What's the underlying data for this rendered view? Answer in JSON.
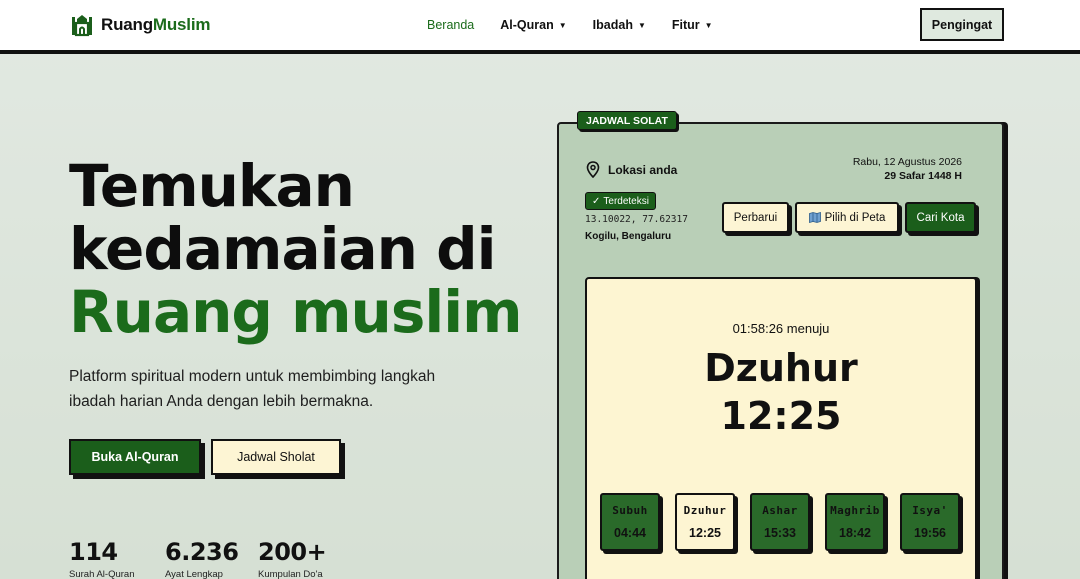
{
  "brand": {
    "name_a": "Ruang",
    "name_b": "Muslim"
  },
  "nav": {
    "items": [
      {
        "label": "Beranda"
      },
      {
        "label": "Al-Quran"
      },
      {
        "label": "Ibadah"
      },
      {
        "label": "Fitur"
      }
    ],
    "cta": "Pengingat"
  },
  "hero": {
    "line1": "Temukan",
    "line2": "kedamaian di",
    "line3": "Ruang muslim",
    "description": "Platform spiritual modern untuk membimbing langkah ibadah harian Anda dengan lebih bermakna.",
    "btn_primary": "Buka Al-Quran",
    "btn_secondary": "Jadwal Sholat"
  },
  "stats": [
    {
      "value": "114",
      "label": "Surah Al-Quran"
    },
    {
      "value": "6.236",
      "label": "Ayat Lengkap"
    },
    {
      "value": "200+",
      "label": "Kumpulan Do'a"
    }
  ],
  "schedule": {
    "badge": "JADWAL SOLAT",
    "location_label": "Lokasi anda",
    "date_gregorian": "Rabu, 12 Agustus 2026",
    "date_hijri": "29 Safar 1448 H",
    "detected_label": "Terdeteksi",
    "coordinates": "13.10022, 77.62317",
    "city": "Kogilu, Bengaluru",
    "btn_refresh": "Perbarui",
    "btn_map": "Pilih di Peta",
    "btn_search": "Cari Kota",
    "countdown_text": "01:58:26 menuju",
    "next_prayer": "Dzuhur",
    "next_time": "12:25",
    "times": [
      {
        "name": "Subuh",
        "time": "04:44"
      },
      {
        "name": "Dzuhur",
        "time": "12:25"
      },
      {
        "name": "Ashar",
        "time": "15:33"
      },
      {
        "name": "Maghrib",
        "time": "18:42"
      },
      {
        "name": "Isya'",
        "time": "19:56"
      }
    ]
  }
}
